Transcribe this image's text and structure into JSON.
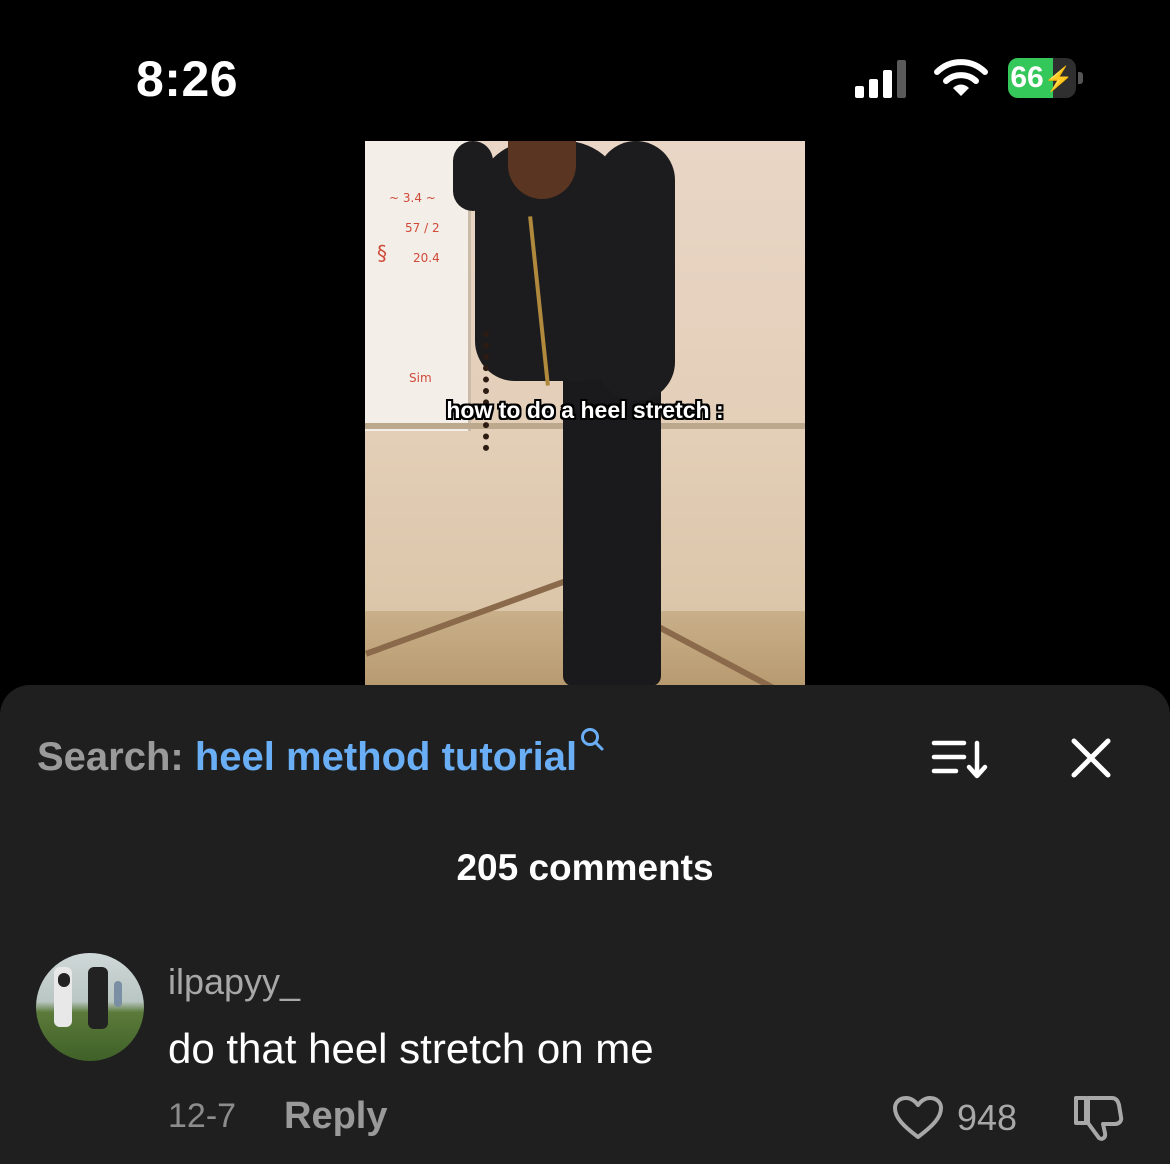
{
  "status_bar": {
    "time": "8:26",
    "battery_level": "66",
    "battery_percent": 66,
    "battery_charging": true,
    "battery_color": "#34c759"
  },
  "video": {
    "caption": "how to do a heel stretch :"
  },
  "comments_sheet": {
    "search_label": "Search:",
    "search_query": "heel method tutorial",
    "search_query_color": "#6aaef5",
    "comment_count": "205 comments",
    "comments": [
      {
        "username": "ilpapyy_",
        "text": "do that heel stretch on me",
        "date": "12-7",
        "reply_label": "Reply",
        "likes": "948"
      }
    ]
  },
  "icons": {
    "signal": "cellular-signal-icon",
    "wifi": "wifi-icon",
    "battery": "battery-charging-icon",
    "search": "search-icon",
    "sort": "sort-icon",
    "close": "close-icon",
    "like": "heart-icon",
    "dislike": "thumbs-down-icon"
  }
}
